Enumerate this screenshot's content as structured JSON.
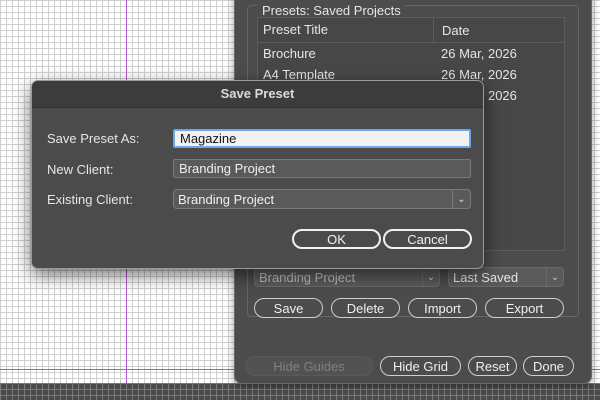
{
  "panel": {
    "group_title": "Presets: Saved Projects",
    "table": {
      "headers": [
        "Preset Title",
        "Date"
      ],
      "rows": [
        {
          "title": "Brochure",
          "date": "26 Mar, 2026"
        },
        {
          "title": "A4 Template",
          "date": "26 Mar, 2026"
        },
        {
          "title": "",
          "date": "26 Mar, 2026"
        }
      ]
    },
    "client_select": "Branding Project",
    "sort_select": "Last Saved",
    "buttons": {
      "save": "Save",
      "delete": "Delete",
      "import": "Import",
      "export": "Export"
    },
    "footer": {
      "hide_guides": "Hide Guides",
      "hide_grid": "Hide Grid",
      "reset": "Reset",
      "done": "Done"
    }
  },
  "dialog": {
    "title": "Save Preset",
    "save_as_label": "Save Preset As:",
    "save_as_value": "Magazine",
    "new_client_label": "New Client:",
    "new_client_value": "Branding Project",
    "existing_client_label": "Existing Client:",
    "existing_client_value": "Branding Project",
    "ok": "OK",
    "cancel": "Cancel"
  }
}
